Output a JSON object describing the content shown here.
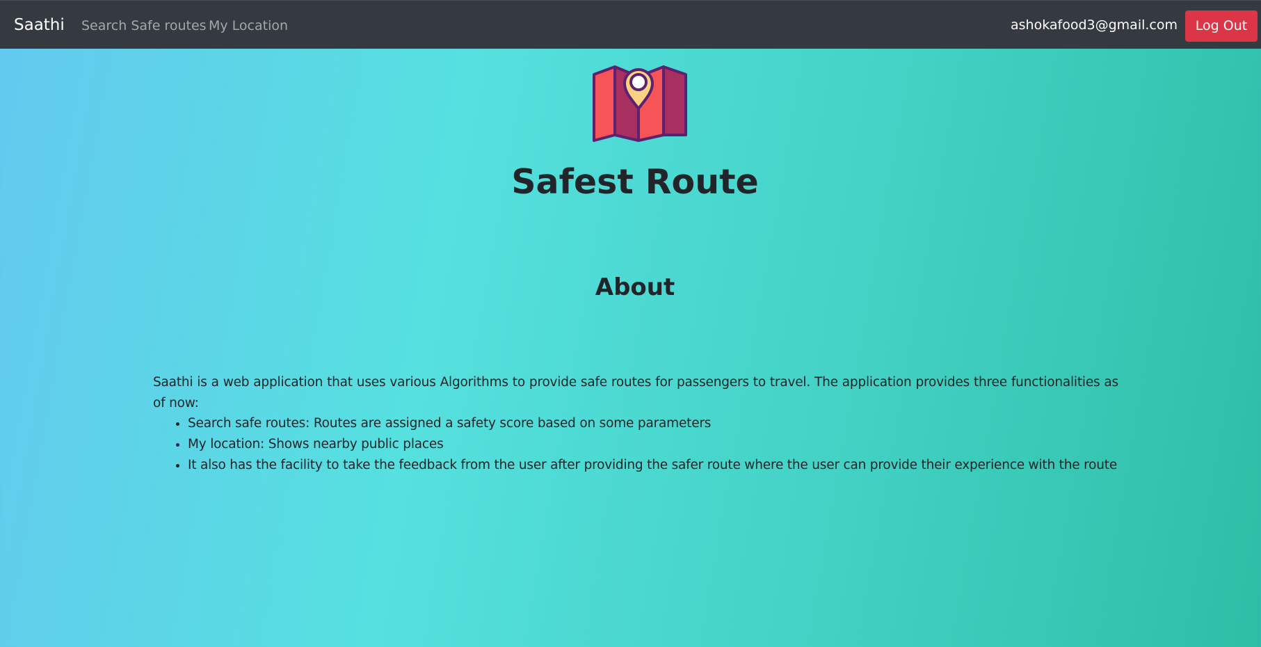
{
  "navbar": {
    "brand": "Saathi",
    "links": [
      {
        "label": "Search Safe routes"
      },
      {
        "label": "My Location"
      }
    ],
    "user_email": "ashokafood3@gmail.com",
    "logout_label": "Log Out",
    "background": "#343a40",
    "logout_color": "#dc3545"
  },
  "hero": {
    "logo_icon": "map-pin-icon",
    "title": "Safest Route"
  },
  "about": {
    "heading": "About",
    "description": "Saathi is a web application that uses various Algorithms to provide safe routes for passengers to travel. The application provides three functionalities as of now:",
    "features": [
      "Search safe routes: Routes are assigned a safety score based on some parameters",
      "My location: Shows nearby public places",
      "It also has the facility to take the feedback from the user after providing the safer route where the user can provide their experience with the route"
    ]
  },
  "colors": {
    "gradient_start": "#63c9ef",
    "gradient_mid": "#56e0df",
    "gradient_end": "#2ebea6",
    "map_red": "#f75458",
    "map_dark": "#a73060",
    "map_outline": "#5c2270",
    "pin_fill": "#fbd281"
  }
}
